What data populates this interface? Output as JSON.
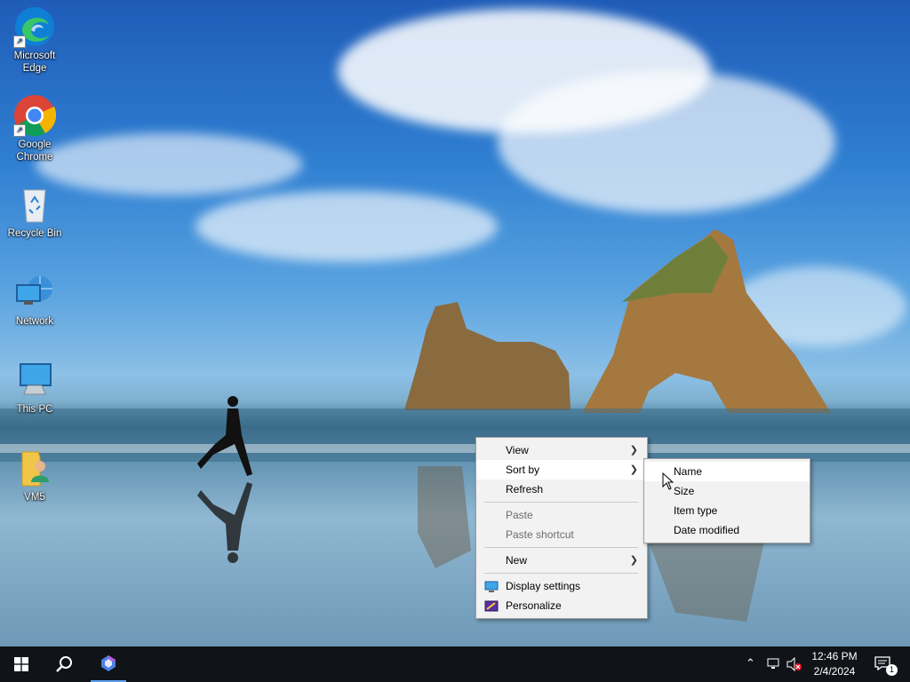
{
  "desktop_icons": [
    {
      "label": "Microsoft Edge",
      "icon": "edge-icon"
    },
    {
      "label": "Google Chrome",
      "icon": "chrome-icon"
    },
    {
      "label": "Recycle Bin",
      "icon": "recycle-bin-icon"
    },
    {
      "label": "Network",
      "icon": "network-icon"
    },
    {
      "label": "This PC",
      "icon": "this-pc-icon"
    },
    {
      "label": "VM5",
      "icon": "user-folder-icon"
    }
  ],
  "context_menu": {
    "items": [
      {
        "label": "View",
        "submenu": true
      },
      {
        "label": "Sort by",
        "submenu": true
      },
      {
        "label": "Refresh"
      },
      {
        "label": "Paste",
        "disabled": true
      },
      {
        "label": "Paste shortcut",
        "disabled": true
      },
      {
        "label": "New",
        "submenu": true
      },
      {
        "label": "Display settings",
        "icon": "display-settings-icon"
      },
      {
        "label": "Personalize",
        "icon": "personalize-icon"
      }
    ]
  },
  "sort_submenu": {
    "items": [
      {
        "label": "Name"
      },
      {
        "label": "Size"
      },
      {
        "label": "Item type"
      },
      {
        "label": "Date modified"
      }
    ]
  },
  "taskbar": {
    "clock_time": "12:46 PM",
    "clock_date": "2/4/2024",
    "notification_count": "1"
  },
  "colors": {
    "taskbar": "#101418",
    "menu_bg": "#f2f2f2",
    "accent": "#0078d4"
  }
}
